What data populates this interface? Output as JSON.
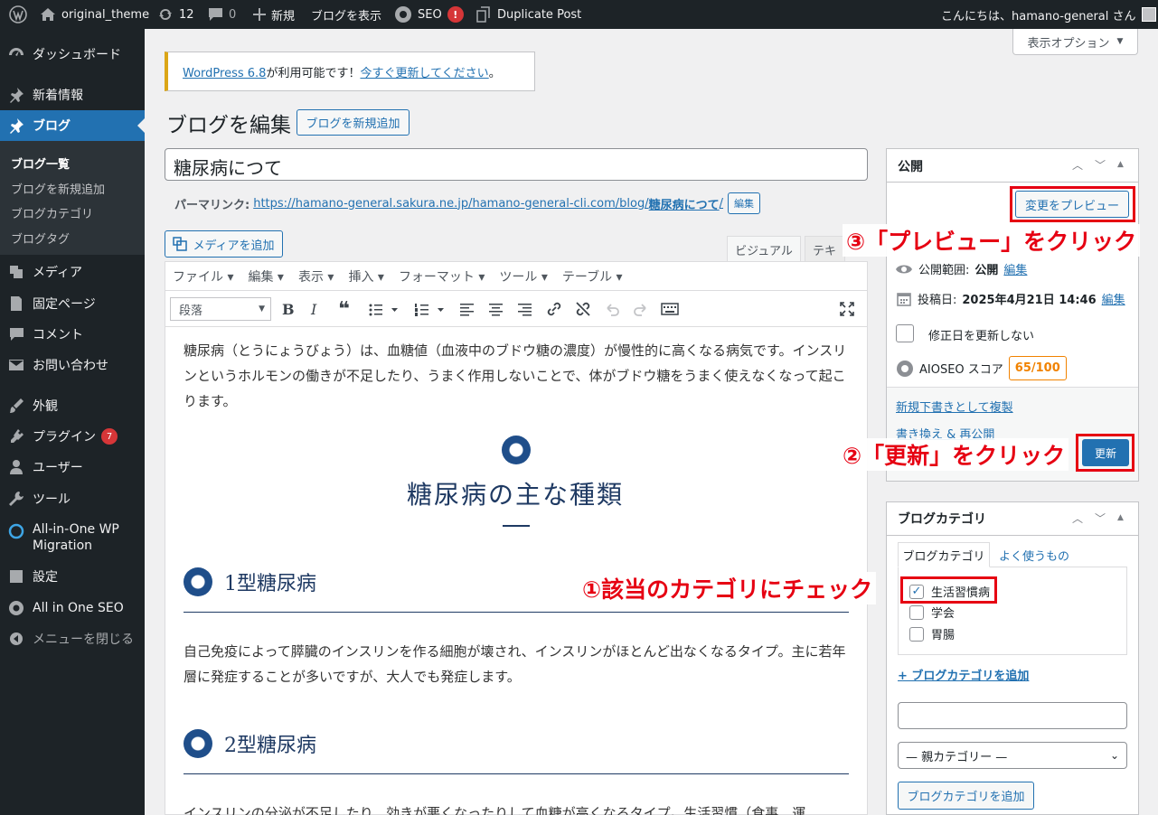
{
  "adminbar": {
    "site_name": "original_theme",
    "updates_count": "12",
    "comments_count": "0",
    "new_label": "新規",
    "view_blog": "ブログを表示",
    "seo_label": "SEO",
    "seo_badge": "!",
    "duplicate_post": "Duplicate Post",
    "greeting": "こんにちは、hamano-general さん"
  },
  "sidebar": {
    "dashboard": "ダッシュボード",
    "news": "新着情報",
    "blog": "ブログ",
    "blog_subs": [
      "ブログ一覧",
      "ブログを新規追加",
      "ブログカテゴリ",
      "ブログタグ"
    ],
    "media": "メディア",
    "pages": "固定ページ",
    "comments": "コメント",
    "contact": "お問い合わせ",
    "appearance": "外観",
    "plugins": "プラグイン",
    "plugins_badge": "7",
    "users": "ユーザー",
    "tools": "ツール",
    "aio_migration": "All-in-One WP Migration",
    "settings": "設定",
    "aioseo": "All in One SEO",
    "collapse": "メニューを閉じる"
  },
  "screen_options": "表示オプション",
  "notice": {
    "link1": "WordPress 6.8",
    "text": "が利用可能です！",
    "link2": "今すぐ更新してください",
    "end": "。"
  },
  "page_title": "ブログを編集",
  "add_new": "ブログを新規追加",
  "post_title": "糖尿病につて",
  "permalink": {
    "label": "パーマリンク:",
    "url_base": "https://hamano-general.sakura.ne.jp/hamano-general-cli.com/blog/",
    "slug": "糖尿病につて",
    "slash": "/",
    "edit": "編集"
  },
  "add_media": "メディアを追加",
  "tabs": {
    "visual": "ビジュアル",
    "text": "テキ"
  },
  "menubar": [
    "ファイル",
    "編集",
    "表示",
    "挿入",
    "フォーマット",
    "ツール",
    "テーブル"
  ],
  "format_select": "段落",
  "content": {
    "p1": "糖尿病（とうにょうびょう）は、血糖値（血液中のブドウ糖の濃度）が慢性的に高くなる病気です。インスリンというホルモンの働きが不足したり、うまく作用しないことで、体がブドウ糖をうまく使えなくなって起こります。",
    "heading": "糖尿病の主な種類",
    "h3_1": "1型糖尿病",
    "p2": "自己免疫によって膵臓のインスリンを作る細胞が壊され、インスリンがほとんど出なくなるタイプ。主に若年層に発症することが多いですが、大人でも発症します。",
    "h3_2": "2型糖尿病",
    "p3": "インスリンの分泌が不足したり、効きが悪くなったりして血糖が高くなるタイプ。生活習慣（食事、運"
  },
  "publish": {
    "title": "公開",
    "preview": "変更をプレビュー",
    "visibility_label": "公開範囲:",
    "visibility_value": "公開",
    "visibility_edit": "編集",
    "date_label": "投稿日:",
    "date_value": "2025年4月21日 14:46",
    "date_edit": "編集",
    "no_update_date": "修正日を更新しない",
    "aioseo_label": "AIOSEO スコア",
    "aioseo_score": "65/100",
    "copy_draft": "新規下書きとして複製",
    "rewrite": "書き換え & 再公開",
    "update": "更新"
  },
  "category_box": {
    "title": "ブログカテゴリ",
    "tab_all": "ブログカテゴリ",
    "tab_popular": "よく使うもの",
    "items": [
      "生活習慣病",
      "学会",
      "胃腸"
    ],
    "add_link": "+ ブログカテゴリを追加",
    "parent_select": "— 親カテゴリー —",
    "add_button": "ブログカテゴリを追加"
  },
  "annotations": {
    "a1": "①該当のカテゴリにチェック",
    "a2": "②「更新」をクリック",
    "a3": "③「プレビュー」をクリック"
  }
}
